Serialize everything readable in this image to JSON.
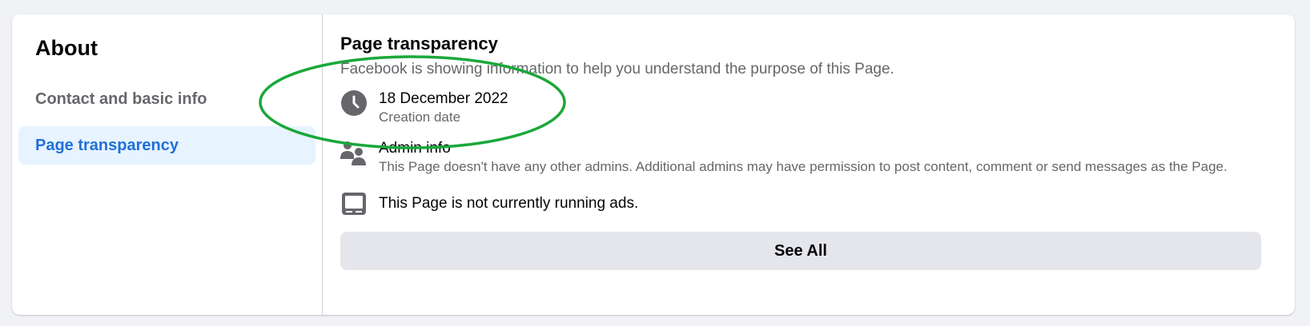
{
  "sidebar": {
    "title": "About",
    "items": [
      {
        "label": "Contact and basic info",
        "active": false
      },
      {
        "label": "Page transparency",
        "active": true
      }
    ]
  },
  "main": {
    "title": "Page transparency",
    "subtitle": "Facebook is showing information to help you understand the purpose of this Page.",
    "creation": {
      "value": "18 December 2022",
      "label": "Creation date",
      "icon": "clock-icon"
    },
    "admin": {
      "title": "Admin info",
      "description": "This Page doesn't have any other admins. Additional admins may have permission to post content, comment or send messages as the Page.",
      "icon": "admins-icon"
    },
    "ads": {
      "text": "This Page is not currently running ads.",
      "icon": "ads-screen-icon"
    },
    "see_all_label": "See All"
  },
  "colors": {
    "background": "#f0f2f5",
    "accent": "#216fdb",
    "active_bg": "#e7f3ff",
    "secondary_text": "#65676b",
    "icon_gray": "#65676b",
    "annotation_green": "#1aa83a"
  }
}
